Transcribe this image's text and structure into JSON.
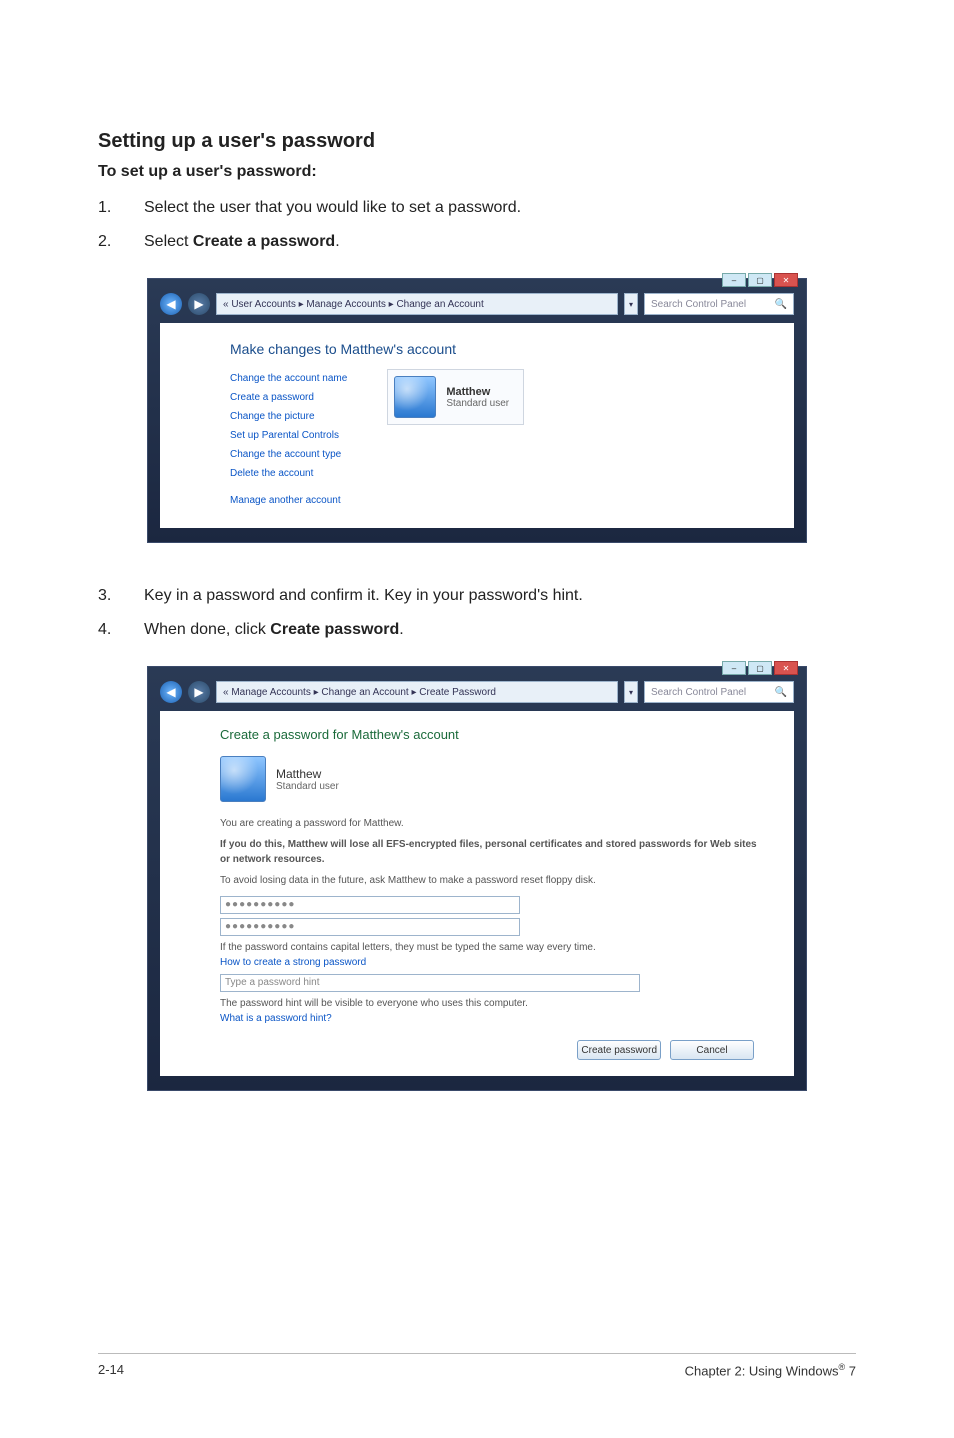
{
  "doc": {
    "title": "Setting up a user's password",
    "subtitle": "To set up a user's password:",
    "steps_a": [
      {
        "num": "1.",
        "text": "Select the user that you would like to set a password."
      },
      {
        "num": "2.",
        "pre": "Select ",
        "bold": "Create a password",
        "post": "."
      }
    ],
    "steps_b": [
      {
        "num": "3.",
        "text": "Key in a password and confirm it. Key in your password's hint."
      },
      {
        "num": "4.",
        "pre": "When done, click ",
        "bold": "Create password",
        "post": "."
      }
    ]
  },
  "shot1": {
    "breadcrumb": "« User Accounts ▸ Manage Accounts ▸ Change an Account",
    "search_placeholder": "Search Control Panel",
    "heading": "Make changes to Matthew's account",
    "links": [
      "Change the account name",
      "Create a password",
      "Change the picture",
      "Set up Parental Controls",
      "Change the account type",
      "Delete the account",
      "Manage another account"
    ],
    "user": {
      "name": "Matthew",
      "type": "Standard user"
    }
  },
  "shot2": {
    "breadcrumb": "« Manage Accounts ▸ Change an Account ▸ Create Password",
    "search_placeholder": "Search Control Panel",
    "heading": "Create a password for Matthew's account",
    "user": {
      "name": "Matthew",
      "type": "Standard user"
    },
    "line1": "You are creating a password for Matthew.",
    "warn": "If you do this, Matthew will lose all EFS-encrypted files, personal certificates and stored passwords for Web sites or network resources.",
    "line2": "To avoid losing data in the future, ask Matthew to make a password reset floppy disk.",
    "pw_mask": "●●●●●●●●●●",
    "cap_line": "If the password contains capital letters, they must be typed the same way every time.",
    "cap_link": "How to create a strong password",
    "hint_placeholder": "Type a password hint",
    "hint_line": "The password hint will be visible to everyone who uses this computer.",
    "hint_link": "What is a password hint?",
    "btn_create": "Create password",
    "btn_cancel": "Cancel"
  },
  "footer": {
    "left": "2-14",
    "right_pre": "Chapter 2: Using Windows",
    "right_post": " 7",
    "reg": "®"
  }
}
